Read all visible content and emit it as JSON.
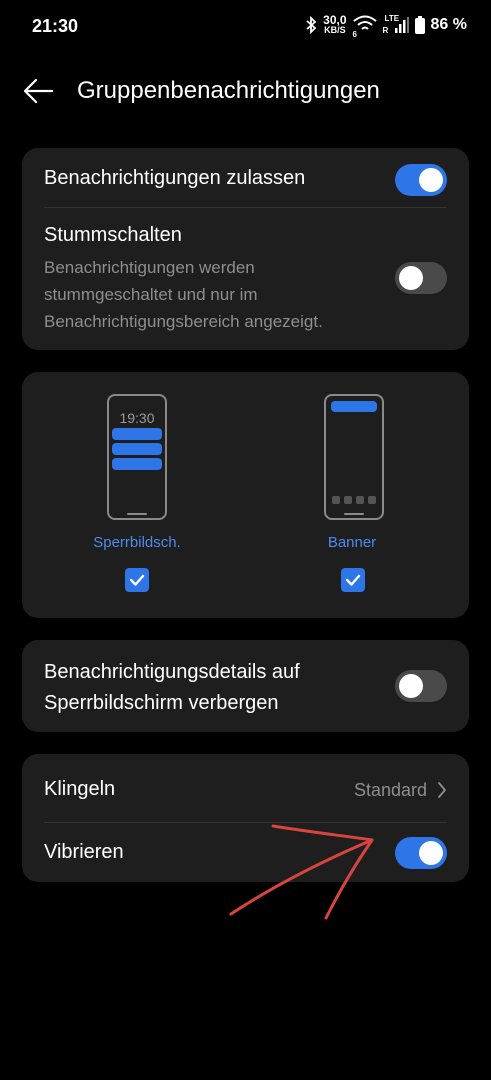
{
  "status_bar": {
    "time": "21:30",
    "speed_top": "30,0",
    "speed_unit": "KB/S",
    "wifi_badge": "6",
    "lte_label": "LTE",
    "roaming_label": "R",
    "battery": "86 %",
    "icons": [
      "bluetooth-icon",
      "wifi-icon",
      "signal-icon",
      "battery-icon"
    ]
  },
  "header": {
    "title": "Gruppenbenachrichtigungen",
    "back_icon": "arrow-left-icon"
  },
  "card1": {
    "allow_label": "Benachrichtigungen zulassen",
    "allow_on": true,
    "mute_label": "Stummschalten",
    "mute_desc": "Benachrichtigungen werden stummgeschaltet und nur im Benachrichtigungsbereich angezeigt.",
    "mute_on": false
  },
  "card2": {
    "lock_preview_time": "19:30",
    "lock_label": "Sperrbildsch.",
    "lock_checked": true,
    "banner_label": "Banner",
    "banner_checked": true
  },
  "card3": {
    "hide_details_label": "Benachrichtigungsdetails auf Sperrbildschirm verbergen",
    "hide_details_on": false
  },
  "card4": {
    "ring_label": "Klingeln",
    "ring_value": "Standard",
    "vibrate_label": "Vibrieren",
    "vibrate_on": true
  },
  "colors": {
    "accent": "#2e76e8",
    "card_bg": "#1e1e1e",
    "annotation": "#d9443f"
  }
}
